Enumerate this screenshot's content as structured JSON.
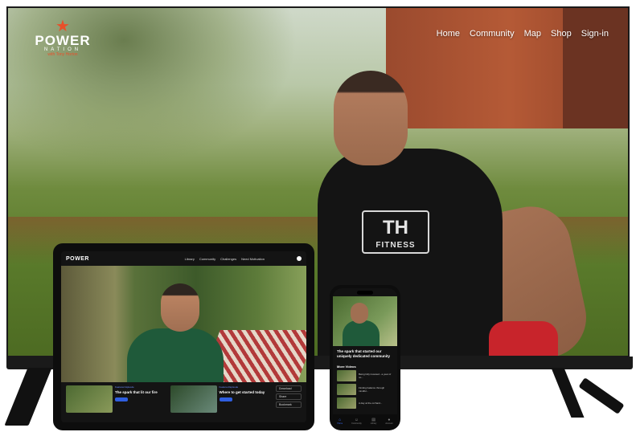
{
  "tv": {
    "brand": {
      "name": "POWER",
      "sub": "NATION",
      "tagline": "with Tony Horton"
    },
    "nav": [
      "Home",
      "Community",
      "Map",
      "Shop",
      "Sign-in"
    ],
    "shirt_text": "FITNESS",
    "shirt_mark": "TH"
  },
  "tablet": {
    "brand": "POWER",
    "nav": [
      "Library",
      "Community",
      "Challenges",
      "Need Motivation"
    ],
    "cards": [
      {
        "tag": "Featured Episode",
        "title": "The spark that lit our fire",
        "desc": ""
      },
      {
        "tag": "Featured Episode",
        "title": "Where to get started today",
        "desc": ""
      }
    ],
    "actions": [
      "Download",
      "Share",
      "Bookmark"
    ]
  },
  "phone": {
    "title": "The spark that started our uniquely dedicated community",
    "more_label": "More Videos",
    "list": [
      "Being fully invested - a year of no...",
      "Finding balance through mindful...",
      "A day at the orchard..."
    ],
    "tabs": [
      {
        "icon": "home-icon",
        "label": "Home",
        "active": true
      },
      {
        "icon": "community-icon",
        "label": "Community",
        "active": false
      },
      {
        "icon": "library-icon",
        "label": "Library",
        "active": false
      },
      {
        "icon": "account-icon",
        "label": "Account",
        "active": false
      }
    ]
  }
}
